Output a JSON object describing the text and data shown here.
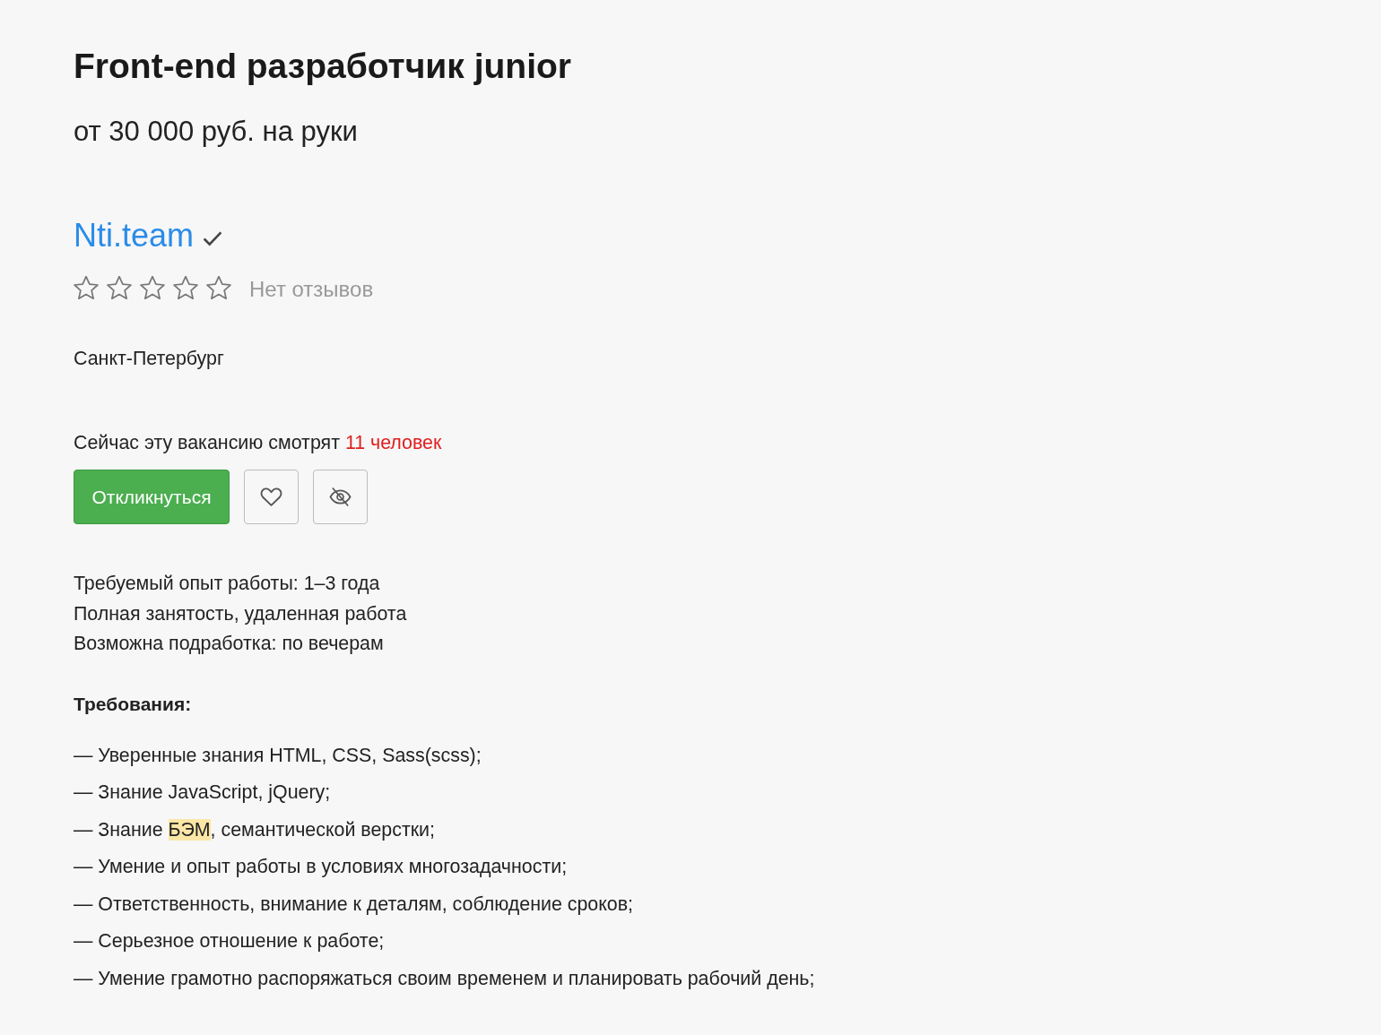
{
  "vacancy": {
    "title": "Front-end разработчик junior",
    "salary": "от 30 000 руб. на руки"
  },
  "employer": {
    "name": "Nti.team",
    "verified": true,
    "rating": {
      "stars": 0,
      "reviews": "Нет отзывов"
    }
  },
  "location": "Санкт-Петербург",
  "viewers": {
    "text": "Сейчас эту вакансию смотрят",
    "count": "11 человек"
  },
  "actions": [
    {
      "kind": "respond",
      "label": "Откликнуться"
    },
    {
      "kind": "favorite"
    },
    {
      "kind": "hide"
    }
  ],
  "details": [
    "Требуемый опыт работы: 1–3 года",
    "Полная занятость, удаленная работа",
    "Возможна подработка: по вечерам"
  ],
  "requirements": {
    "heading": "Требования:",
    "items": [
      {
        "segments": [
          {
            "text": "— Уверенные знания HTML, CSS, Sass(scss);",
            "highlighted": false
          }
        ]
      },
      {
        "segments": [
          {
            "text": "— Знание JavaScript, jQuery;",
            "highlighted": false
          }
        ]
      },
      {
        "segments": [
          {
            "text": "— Знание ",
            "highlighted": false
          },
          {
            "text": "БЭМ",
            "highlighted": true
          },
          {
            "text": ", семантической верстки;",
            "highlighted": false
          }
        ]
      },
      {
        "segments": [
          {
            "text": "— Умение и опыт работы в условиях многозадачности;",
            "highlighted": false
          }
        ]
      },
      {
        "segments": [
          {
            "text": "— Ответственность, внимание к деталям, соблюдение сроков;",
            "highlighted": false
          }
        ]
      },
      {
        "segments": [
          {
            "text": "— Серьезное отношение к работе;",
            "highlighted": false
          }
        ]
      },
      {
        "segments": [
          {
            "text": "— Умение грамотно распоряжаться своим временем и планировать рабочий день;",
            "highlighted": false
          }
        ]
      }
    ]
  }
}
